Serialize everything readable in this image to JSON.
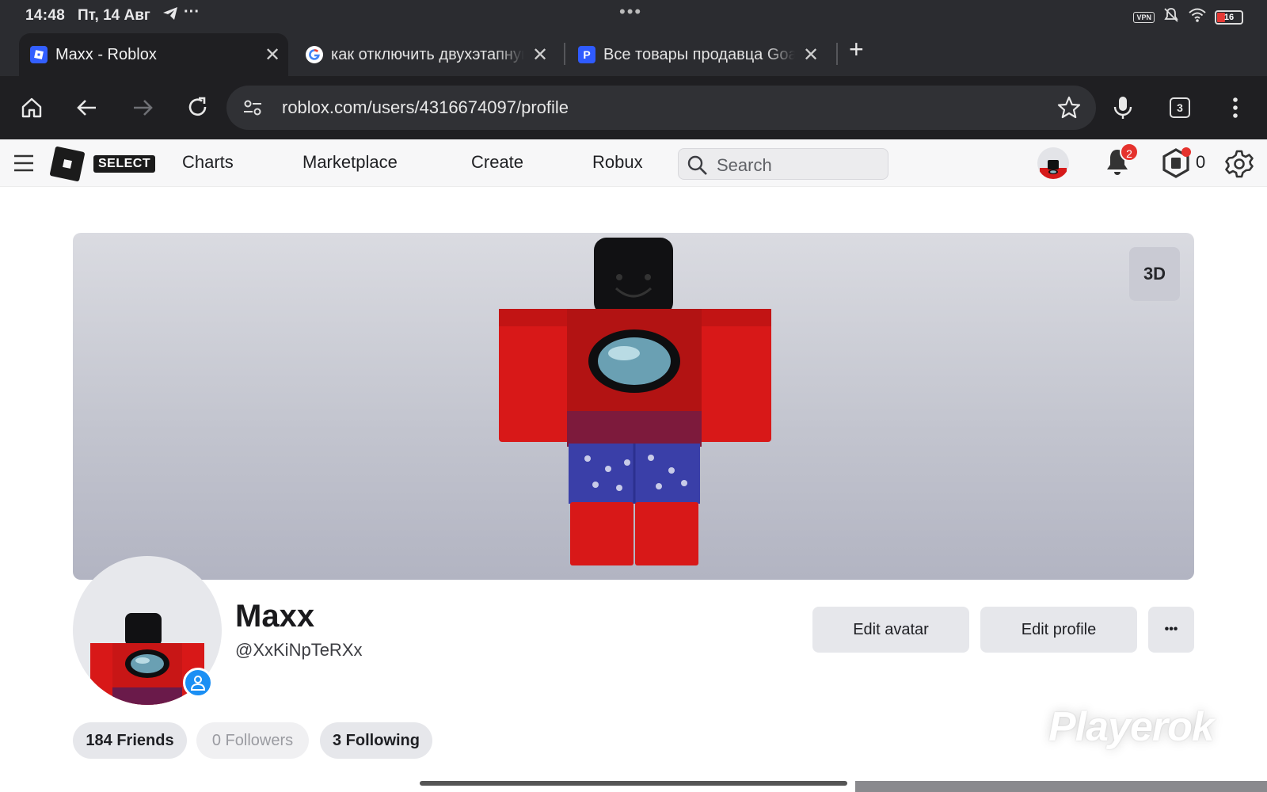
{
  "status_bar": {
    "time": "14:48",
    "date": "Пт, 14 Авг",
    "more": "···",
    "center_dots": "•••",
    "vpn_label": "VPN",
    "battery_level": "16"
  },
  "tabs": [
    {
      "title": "Maxx - Roblox",
      "favicon": "roblox-icon",
      "active": true
    },
    {
      "title": "как отключить двухэтапную",
      "favicon": "google-icon",
      "active": false
    },
    {
      "title": "Все товары продавца Goal",
      "favicon": "playerok-icon",
      "active": false
    }
  ],
  "toolbar": {
    "url": "roblox.com/users/4316674097/profile",
    "tab_count": "3"
  },
  "roblox_nav": {
    "select_badge": "SELECT",
    "items": [
      "Charts",
      "Marketplace",
      "Create",
      "Robux"
    ],
    "search_placeholder": "Search",
    "notification_count": "2",
    "robux_balance": "0"
  },
  "profile": {
    "view_toggle": "3D",
    "display_name": "Maxx",
    "username": "@XxKiNpTeRXx",
    "buttons": {
      "edit_avatar": "Edit avatar",
      "edit_profile": "Edit profile",
      "more": "•••"
    },
    "stats": {
      "friends": "184 Friends",
      "followers": "0 Followers",
      "following": "3 Following"
    }
  },
  "watermark": "Playerok",
  "colors": {
    "chrome_dark": "#1f1f22",
    "tab_strip": "#2b2c30",
    "roblox_nav_bg": "#f7f7f8",
    "notification_badge": "#e5322d",
    "verified_badge": "#1b8ff4",
    "avatar_red": "#d61a1a",
    "avatar_shorts_blue": "#3a3fa8"
  }
}
